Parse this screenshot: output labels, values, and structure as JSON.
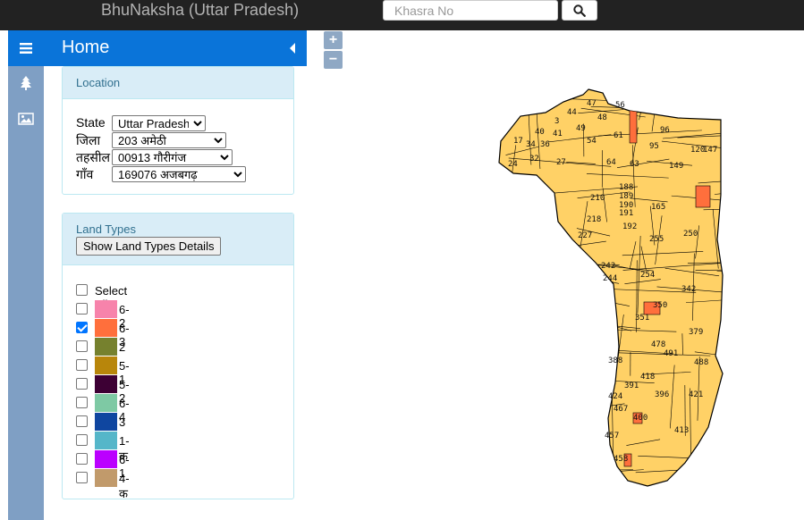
{
  "header": {
    "app_title": "BhuNaksha (Uttar Pradesh)",
    "search_placeholder": "Khasra No",
    "search_icon": "magnifier-icon"
  },
  "sidebar": {
    "home_title": "Home",
    "icons": [
      "tree-icon",
      "image-icon"
    ]
  },
  "location": {
    "title": "Location",
    "fields": [
      {
        "label": "State",
        "value": "Uttar Pradesh"
      },
      {
        "label": "जिला",
        "value": "203 अमेठी"
      },
      {
        "label": "तहसील",
        "value": "00913 गौरीगंज"
      },
      {
        "label": "गाँव",
        "value": "169076 अजबगढ़"
      }
    ]
  },
  "land_types": {
    "title": "Land Types",
    "details_button": "Show Land Types Details",
    "select_all": "Select All",
    "items": [
      {
        "label": "6-2",
        "color": "#f783ab",
        "checked": false
      },
      {
        "label": "6-3",
        "color": "#ff6f3c",
        "checked": true
      },
      {
        "label": "2",
        "color": "#76812e",
        "checked": false
      },
      {
        "label": "5-1",
        "color": "#b8860b",
        "checked": false
      },
      {
        "label": "5-2",
        "color": "#3d0034",
        "checked": false
      },
      {
        "label": "6-4",
        "color": "#7ec9a4",
        "checked": false
      },
      {
        "label": "3",
        "color": "#0f46a0",
        "checked": false
      },
      {
        "label": "1-क",
        "color": "#55b6c9",
        "checked": false
      },
      {
        "label": "6-1",
        "color": "#bb00ff",
        "checked": false
      },
      {
        "label": "4-क",
        "color": "#c19a6b",
        "checked": false
      }
    ]
  },
  "map": {
    "zoom_in": "+",
    "zoom_out": "−",
    "fill_color": "#ffd166",
    "highlight_color": "#ff6f3c",
    "parcel_labels": [
      "47",
      "56",
      "48",
      "61",
      "44",
      "3",
      "40",
      "41",
      "49",
      "34",
      "36",
      "17",
      "24",
      "32",
      "27",
      "64",
      "54",
      "63",
      "95",
      "96",
      "120",
      "147",
      "149",
      "210",
      "188",
      "189",
      "190",
      "191",
      "218",
      "192",
      "165",
      "227",
      "255",
      "250",
      "242",
      "254",
      "244",
      "342",
      "350",
      "351",
      "379",
      "478",
      "491",
      "388",
      "418",
      "488",
      "391",
      "396",
      "421",
      "424",
      "467",
      "400",
      "413",
      "457",
      "458"
    ]
  }
}
